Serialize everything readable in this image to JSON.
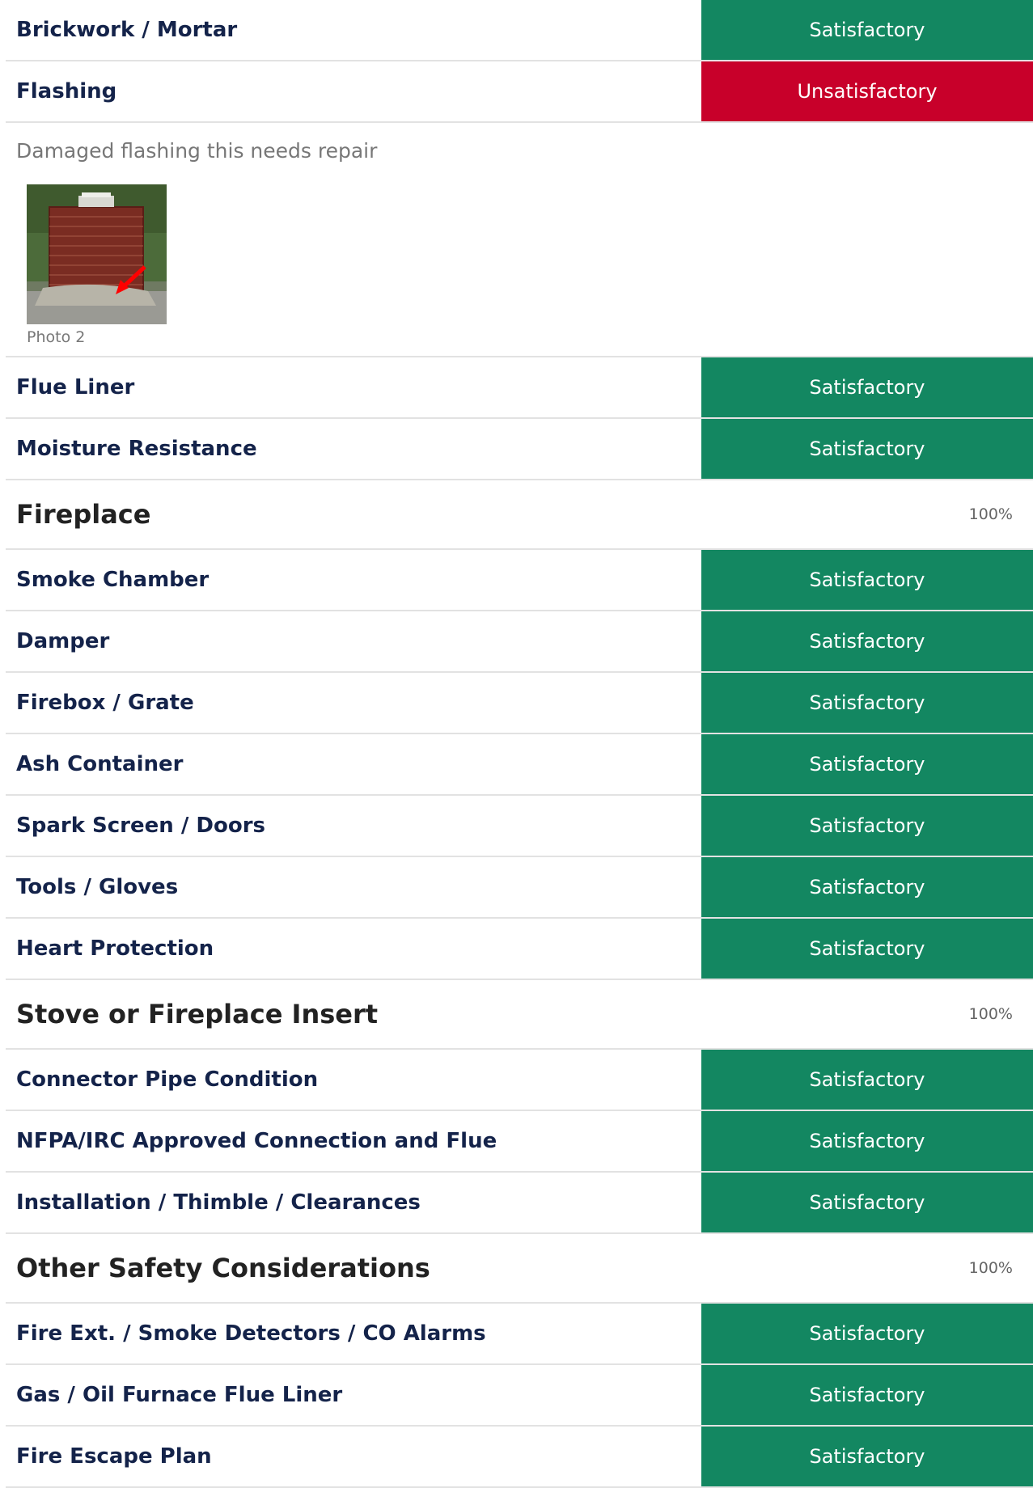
{
  "chimney_top": [
    {
      "label": "Brickwork / Mortar",
      "status": "Satisfactory",
      "state": "sat"
    },
    {
      "label": "Flashing",
      "status": "Unsatisfactory",
      "state": "unsat"
    }
  ],
  "flashing_comment": {
    "text": "Damaged flashing this needs repair",
    "photo_caption": "Photo 2"
  },
  "chimney_bottom": [
    {
      "label": "Flue Liner",
      "status": "Satisfactory",
      "state": "sat"
    },
    {
      "label": "Moisture Resistance",
      "status": "Satisfactory",
      "state": "sat"
    }
  ],
  "sections": [
    {
      "title": "Fireplace",
      "percent": "100%",
      "items": [
        {
          "label": "Smoke Chamber",
          "status": "Satisfactory"
        },
        {
          "label": "Damper",
          "status": "Satisfactory"
        },
        {
          "label": "Firebox / Grate",
          "status": "Satisfactory"
        },
        {
          "label": "Ash Container",
          "status": "Satisfactory"
        },
        {
          "label": "Spark Screen / Doors",
          "status": "Satisfactory"
        },
        {
          "label": "Tools / Gloves",
          "status": "Satisfactory"
        },
        {
          "label": "Heart Protection",
          "status": "Satisfactory"
        }
      ]
    },
    {
      "title": "Stove or Fireplace Insert",
      "percent": "100%",
      "items": [
        {
          "label": "Connector Pipe Condition",
          "status": "Satisfactory"
        },
        {
          "label": "NFPA/IRC Approved Connection and Flue",
          "status": "Satisfactory"
        },
        {
          "label": "Installation / Thimble / Clearances",
          "status": "Satisfactory"
        }
      ]
    },
    {
      "title": "Other Safety Considerations",
      "percent": "100%",
      "items": [
        {
          "label": "Fire Ext. / Smoke Detectors / CO Alarms",
          "status": "Satisfactory"
        },
        {
          "label": "Gas / Oil Furnace Flue Liner",
          "status": "Satisfactory"
        },
        {
          "label": "Fire Escape Plan",
          "status": "Satisfactory"
        }
      ]
    }
  ],
  "colors": {
    "satisfactory": "#138761",
    "unsatisfactory": "#c8002a",
    "label_text": "#14234a"
  }
}
